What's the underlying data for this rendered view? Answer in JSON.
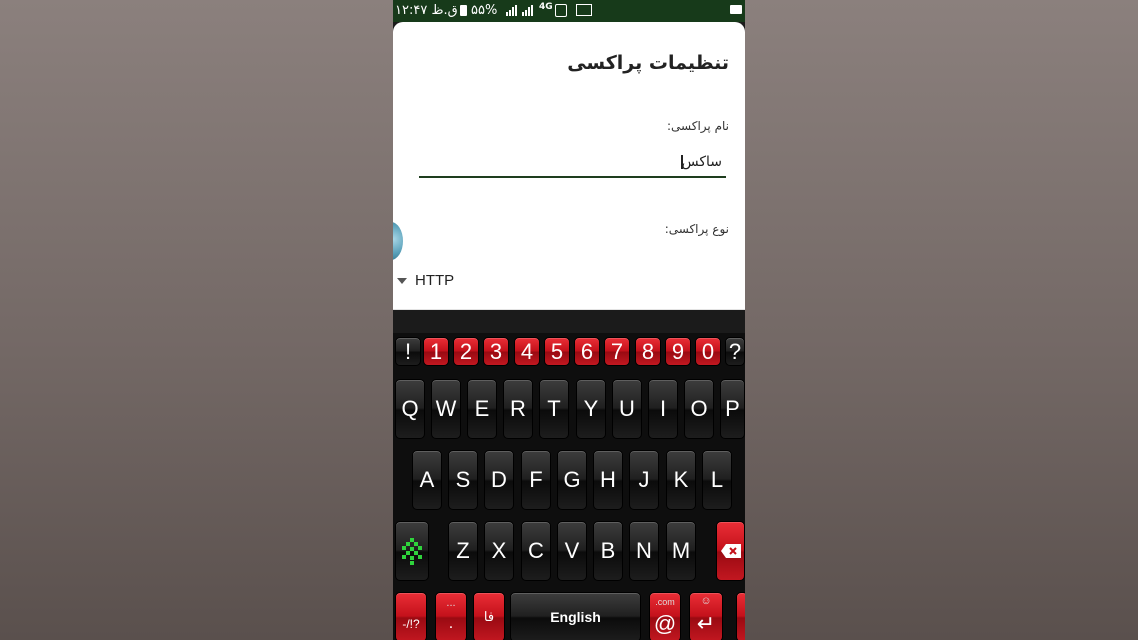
{
  "status_bar": {
    "time": "۱۲:۴۷ ق.ظ",
    "battery": "۵۵%",
    "network": "4G"
  },
  "dialog": {
    "title": "تنظیمات پراکسی",
    "name_label": "نام پراکسی:",
    "name_value": "ساکس",
    "type_label": "نوع پراکسی:",
    "type_value": "HTTP"
  },
  "keyboard": {
    "number_row": [
      "!",
      "1",
      "2",
      "3",
      "4",
      "5",
      "6",
      "7",
      "8",
      "9",
      "0",
      "?"
    ],
    "row1": [
      "Q",
      "W",
      "E",
      "R",
      "T",
      "Y",
      "U",
      "I",
      "O",
      "P"
    ],
    "row2": [
      "A",
      "S",
      "D",
      "F",
      "G",
      "H",
      "J",
      "K",
      "L"
    ],
    "row3": [
      "Z",
      "X",
      "C",
      "V",
      "B",
      "N",
      "M"
    ],
    "symbols_label": "-/!?",
    "dots_label": "...",
    "period_label": ".",
    "lang_switch_label": "فا",
    "space_label": "English",
    "dotcom_label": ".com",
    "at_label": "@",
    "enter_label": "↵",
    "emoji_label": "☺",
    "colors": {
      "accent_red": "#c4111b",
      "key_dark": "#202020",
      "shift_green": "#2fd33c",
      "status_green": "#173a1a"
    }
  }
}
